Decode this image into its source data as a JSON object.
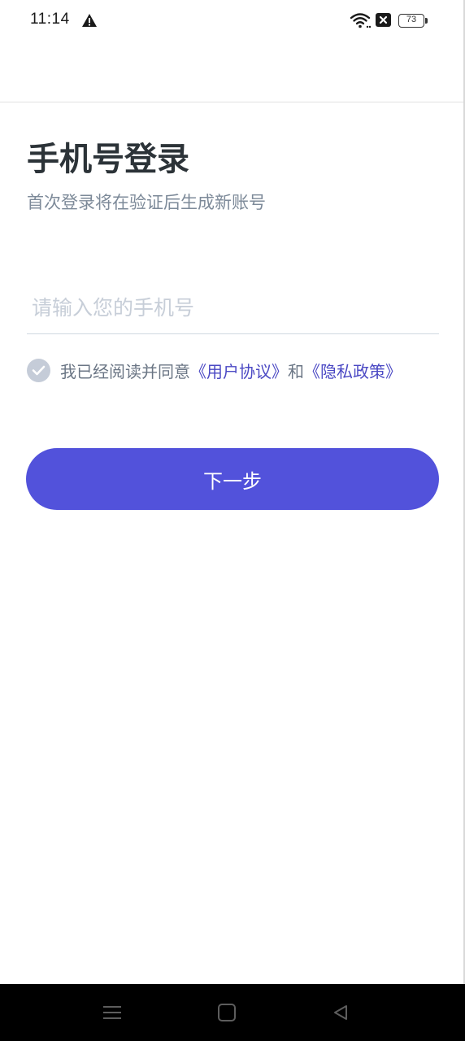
{
  "status_bar": {
    "time": "11:14",
    "battery": "73"
  },
  "login": {
    "title": "手机号登录",
    "subtitle": "首次登录将在验证后生成新账号",
    "phone_placeholder": "请输入您的手机号",
    "phone_value": "",
    "agree_prefix": "我已经阅读并同意",
    "user_agreement": "《用户协议》",
    "agree_and": "和",
    "privacy_policy": "《隐私政策》",
    "agree_checked": true,
    "next_button": "下一步"
  },
  "colors": {
    "accent": "#5252db",
    "link": "#4b49c4",
    "title": "#2c3338",
    "subtitle": "#7d8a99",
    "checkbox": "#c5ccd8"
  },
  "icons": {
    "warning": "warning-icon",
    "wifi": "wifi-icon",
    "sim": "no-sim-icon",
    "check": "check-icon",
    "nav_menu": "menu-icon",
    "nav_home": "home-icon",
    "nav_back": "back-icon"
  }
}
